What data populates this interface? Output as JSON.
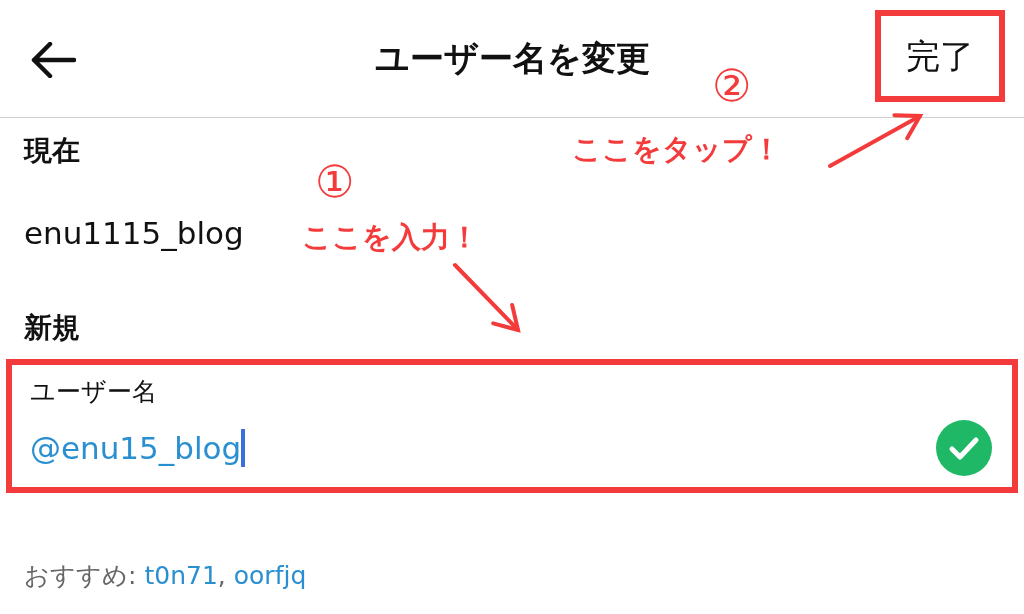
{
  "header": {
    "title": "ユーザー名を変更",
    "done_button": "完了",
    "done_highlighted": true
  },
  "current": {
    "heading": "現在",
    "username": "enu1115_blog"
  },
  "new": {
    "heading": "新規",
    "field_label": "ユーザー名",
    "value": "@enu15_blog",
    "valid": true,
    "highlighted": true
  },
  "suggestions": {
    "label": "おすすめ:",
    "items": [
      {
        "text": "t0n71",
        "separator": ","
      },
      {
        "text": "oorfjq"
      }
    ]
  },
  "annotations": [
    {
      "kind": "step",
      "number": "①",
      "text": "ここを入力！"
    },
    {
      "kind": "step",
      "number": "②",
      "text": "ここをタップ！"
    }
  ]
}
